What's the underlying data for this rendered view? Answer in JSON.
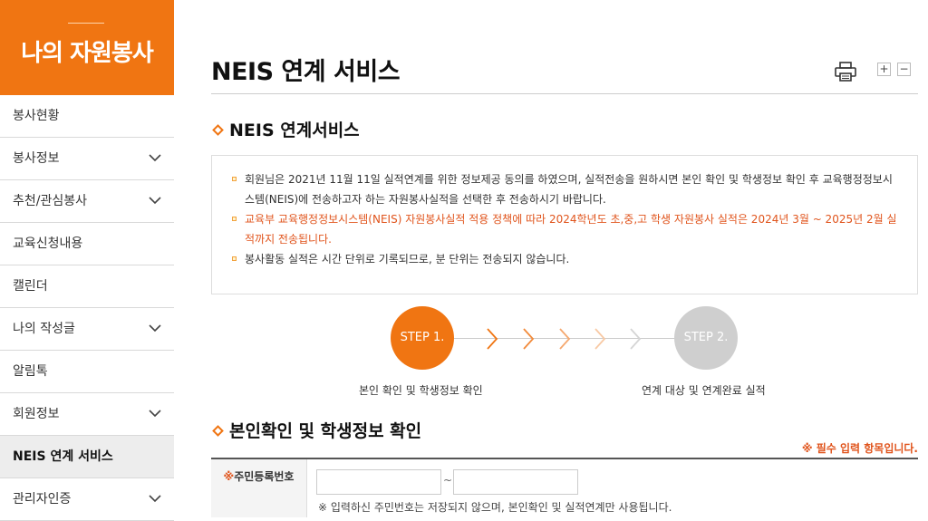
{
  "sidebar": {
    "title": "나의 자원봉사",
    "items": [
      {
        "label": "봉사현황"
      },
      {
        "label": "봉사정보"
      },
      {
        "label": "추천/관심봉사"
      },
      {
        "label": "교육신청내용"
      },
      {
        "label": "캘린더"
      },
      {
        "label": "나의 작성글"
      },
      {
        "label": "알림톡"
      },
      {
        "label": "회원정보"
      },
      {
        "label": "NEIS 연계 서비스"
      },
      {
        "label": "관리자인증"
      }
    ]
  },
  "page": {
    "title": "NEIS 연계 서비스",
    "zoom_in": "+",
    "zoom_out": "−"
  },
  "section1": {
    "title": "NEIS 연계서비스",
    "notices": [
      "회원님은 2021년 11월 11일 실적연계를 위한 정보제공 동의를 하였으며, 실적전송을 원하시면 본인 확인 및 학생정보 확인 후 교육행정정보시스템(NEIS)에 전송하고자 하는 자원봉사실적을 선택한 후 전송하시기 바랍니다.",
      "교육부 교육행정정보시스템(NEIS) 자원봉사실적 적용 정책에 따라 2024학년도 초,중,고 학생 자원봉사 실적은 2024년 3월 ~ 2025년 2월 실적까지 전송됩니다.",
      "봉사활동 실적은 시간 단위로 기록되므로, 분 단위는 전송되지 않습니다."
    ]
  },
  "steps": {
    "step1": "STEP 1.",
    "step2": "STEP 2.",
    "step1_label": "본인 확인 및 학생정보 확인",
    "step2_label": "연계 대상 및 연계완료 실적"
  },
  "section2": {
    "title": "본인확인 및 학생정보 확인",
    "required_note": "※ 필수 입력 항목입니다.",
    "ssn_label_mark": "※",
    "ssn_label": "주민등록번호",
    "ssn_separator": "~",
    "ssn_note": "※ 입력하신 주민번호는 저장되지 않으며, 본인확인 및 실적연계만 사용됩니다.",
    "ssn_front_value": "",
    "ssn_back_value": ""
  },
  "colors": {
    "accent": "#f07512",
    "warning_text": "#e0541c",
    "step_inactive": "#cfcfcf"
  }
}
